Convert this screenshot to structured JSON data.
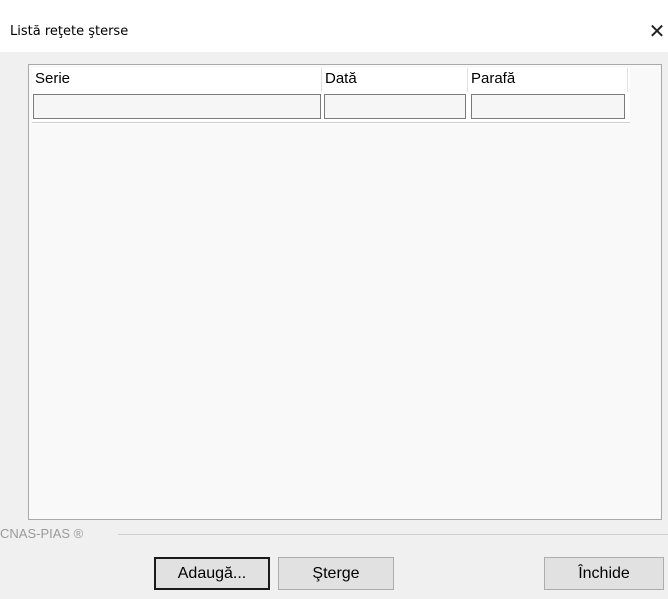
{
  "window": {
    "title": "Listă reţete şterse",
    "close_glyph": "✕"
  },
  "table": {
    "columns": [
      "Serie",
      "Dată",
      "Parafă"
    ]
  },
  "brand": "CNAS-PIAS ®",
  "buttons": {
    "add": "Adaugă...",
    "delete": "Şterge",
    "close": "Închide"
  }
}
